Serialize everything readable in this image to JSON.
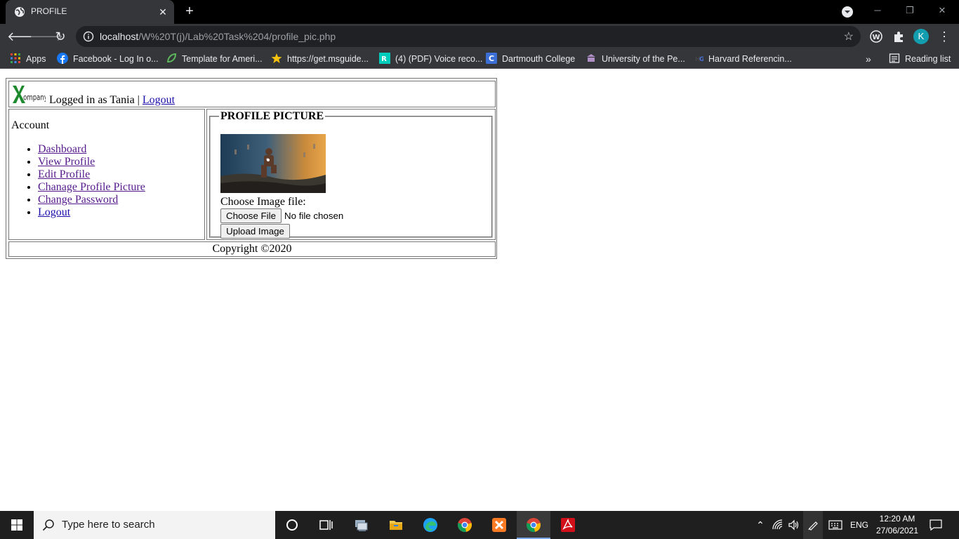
{
  "browser": {
    "tab_title": "PROFILE",
    "url_host": "localhost",
    "url_path": "/W%20T(j)/Lab%20Task%204/profile_pic.php",
    "profile_initial": "K",
    "reading_list": "Reading list",
    "bookmarks": [
      {
        "label": "Apps",
        "icon": "apps-grid-icon"
      },
      {
        "label": "Facebook - Log In o...",
        "icon": "facebook-icon"
      },
      {
        "label": "Template for Ameri...",
        "icon": "leaf-icon"
      },
      {
        "label": "https://get.msguide...",
        "icon": "star-icon"
      },
      {
        "label": "(4) (PDF) Voice reco...",
        "icon": "researchgate-icon"
      },
      {
        "label": "Dartmouth College",
        "icon": "dartmouth-icon"
      },
      {
        "label": "University of the Pe...",
        "icon": "university-icon"
      },
      {
        "label": "Harvard Referencin...",
        "icon": "harvard-icon"
      }
    ]
  },
  "page": {
    "logo_text": "XCompany",
    "logged_in_text": "Logged in as Tania",
    "separator": "|",
    "logout_label": "Logout",
    "sidebar_title": "Account",
    "nav_items": [
      "Dashboard",
      "View Profile",
      "Edit Profile",
      "Chanage Profile Picture",
      "Change Password",
      "Logout"
    ],
    "legend": "PROFILE PICTURE",
    "choose_label": "Choose Image file:",
    "choose_file_button": "Choose File",
    "file_status": "No file chosen",
    "upload_button": "Upload Image",
    "footer": "Copyright ©2020"
  },
  "taskbar": {
    "search_placeholder": "Type here to search",
    "language": "ENG",
    "time": "12:20 AM",
    "date": "27/06/2021"
  },
  "colors": {
    "link": "#1a0dab",
    "visited_link": "#551a8b",
    "chrome_dark": "#35363a",
    "taskbar": "#1f1f1f"
  }
}
